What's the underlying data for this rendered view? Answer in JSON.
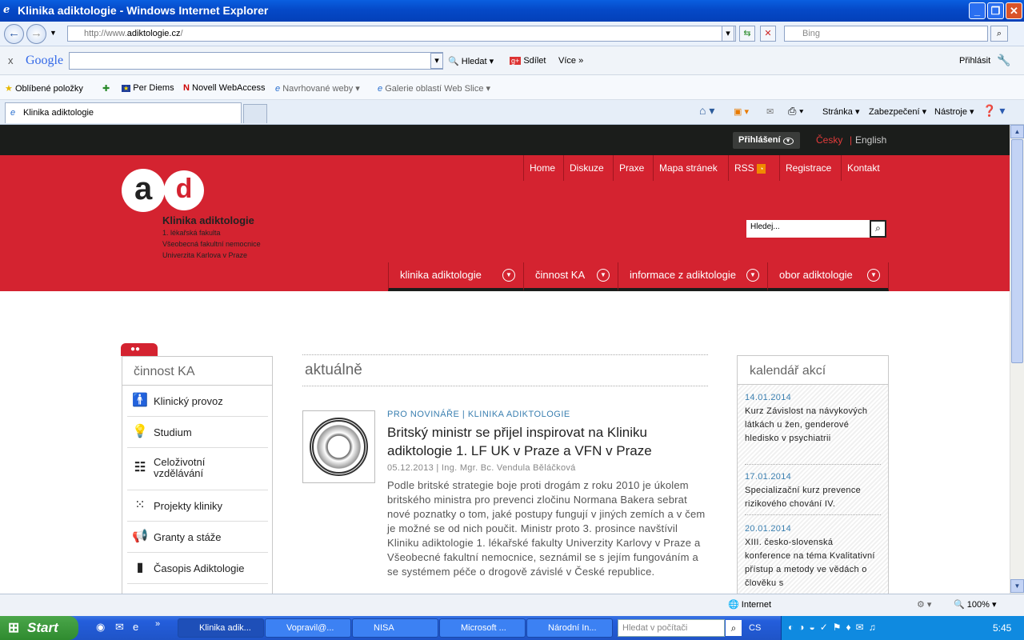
{
  "window": {
    "title": "Klinika adiktologie - Windows Internet Explorer"
  },
  "address": {
    "url_prefix": "http://www.",
    "url_domain": "adiktologie.cz",
    "url_suffix": "/",
    "search_placeholder": "Bing"
  },
  "googlebar": {
    "logo": "Google",
    "hledat": "Hledat",
    "sdilet": "Sdílet",
    "vice": "Více",
    "prihlasit": "Přihlásit"
  },
  "favorites": {
    "label": "Oblíbené položky",
    "items": [
      "Per Diems",
      "Novell WebAccess",
      "Navrhované weby",
      "Galerie oblastí Web Slice"
    ]
  },
  "tabs": {
    "active": "Klinika adiktologie",
    "commands": [
      "Stránka",
      "Zabezpečení",
      "Nástroje"
    ]
  },
  "site": {
    "login": "Přihlášení",
    "lang_cz": "Česky",
    "lang_sep": "|",
    "lang_en": "English",
    "toplinks": [
      "Home",
      "Diskuze",
      "Praxe",
      "Mapa stránek",
      "RSS",
      "Registrace",
      "Kontakt"
    ],
    "logo_title": "Klinika adiktologie",
    "logo_sub": [
      "1. lékařská fakulta",
      "Všeobecná fakultní nemocnice",
      "Univerzita Karlova v Praze"
    ],
    "search_placeholder": "Hledej...",
    "mainnav": [
      "klinika adiktologie",
      "činnost KA",
      "informace z adiktologie",
      "obor adiktologie"
    ],
    "sidebar": {
      "title": "činnost KA",
      "items": [
        "Klinický provoz",
        "Studium",
        "Celoživotní vzdělávání",
        "Projekty kliniky",
        "Granty a stáže",
        "Časopis Adiktologie"
      ]
    },
    "main": {
      "heading": "aktuálně",
      "category": "PRO NOVINÁŘE | KLINIKA ADIKTOLOGIE",
      "title": "Britský ministr se přijel inspirovat na Kliniku adiktologie 1. LF UK v Praze a VFN v Praze",
      "meta": "05.12.2013 | Ing. Mgr. Bc. Vendula Běláčková",
      "body": "Podle britské strategie boje proti drogám z roku 2010 je úkolem britského ministra pro prevenci zločinu Normana Bakera sebrat nové poznatky o tom, jaké postupy fungují v jiných zemích a v čem je možné se od nich poučit. Ministr proto 3. prosince navštívil Kliniku adiktologie 1. lékařské fakulty Univerzity Karlovy v Praze a Všeobecné fakultní nemocnice, seznámil se s jejím fungováním a se systémem péče o drogově závislé v České republice."
    },
    "calendar": {
      "title": "kalendář akcí",
      "events": [
        {
          "date": "14.01.2014",
          "text": "Kurz Závislost na návykových látkách u žen, genderové hledisko v psychiatrii"
        },
        {
          "date": "17.01.2014",
          "text": "Specializační kurz prevence rizikového chování IV."
        },
        {
          "date": "20.01.2014",
          "text": "XIII. česko-slovenská konference na téma Kvalitativní přístup a metody ve vědách o člověku s"
        }
      ]
    }
  },
  "status": {
    "zone": "Internet",
    "zoom": "100%"
  },
  "taskbar": {
    "start": "Start",
    "tasks": [
      "Klinika adik...",
      "Vopravil@...",
      "NISA",
      "Microsoft ...",
      "Národní In..."
    ],
    "search_placeholder": "Hledat v počítači",
    "lang": "CS",
    "time": "5:45"
  }
}
